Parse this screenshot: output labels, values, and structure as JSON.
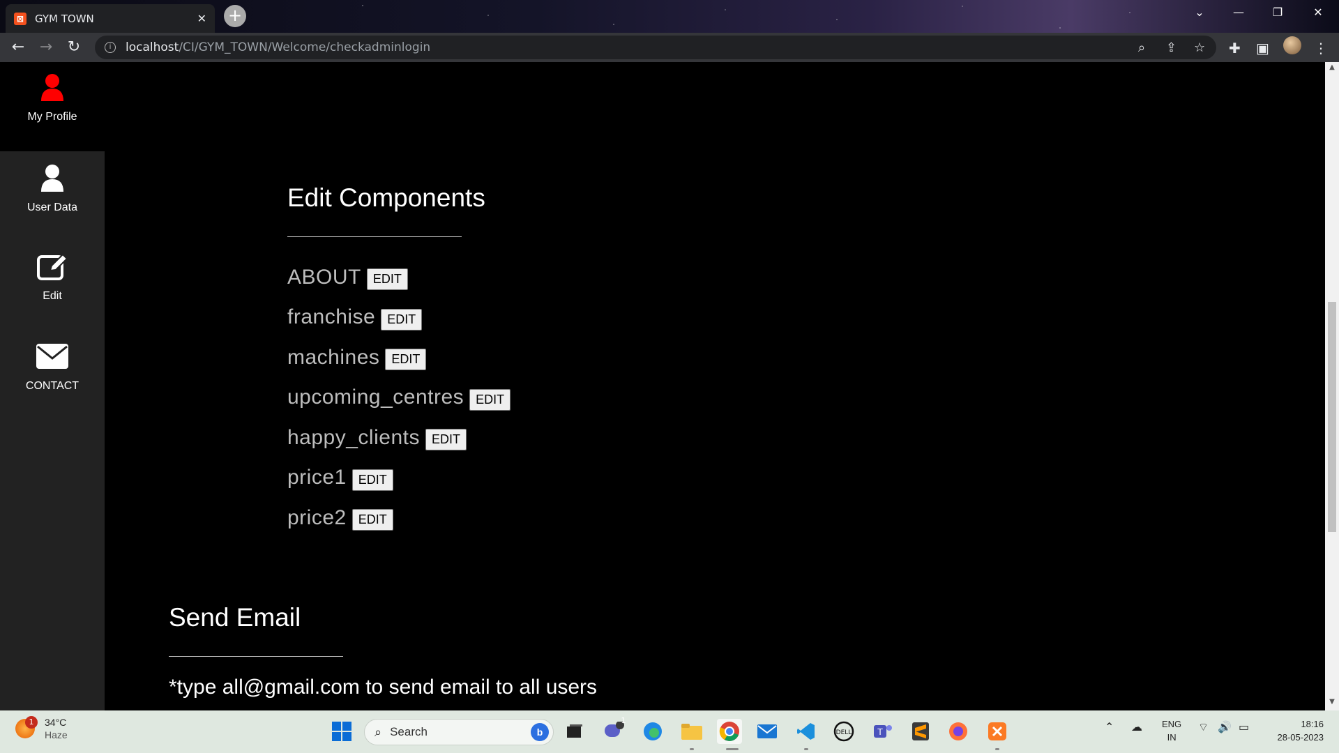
{
  "browser": {
    "tab_title": "GYM TOWN",
    "tab_favicon": "xampp-icon",
    "url_host": "localhost",
    "url_path": "/CI/GYM_TOWN/Welcome/checkadminlogin",
    "icons": [
      "back-arrow-icon",
      "forward-arrow-icon",
      "reload-icon",
      "info-icon",
      "zoom-icon",
      "share-icon",
      "bookmark-star-icon",
      "extensions-icon",
      "sidepanel-icon",
      "profile-avatar",
      "menu-dots-icon"
    ]
  },
  "sidebar": {
    "items": [
      {
        "label": "My Profile",
        "icon": "user-icon",
        "color": "#ff0000"
      },
      {
        "label": "User Data",
        "icon": "user-icon",
        "color": "#ffffff"
      },
      {
        "label": "Edit",
        "icon": "edit-icon",
        "color": "#ffffff"
      },
      {
        "label": "CONTACT",
        "icon": "envelope-icon",
        "color": "#ffffff"
      }
    ]
  },
  "edit_components": {
    "title": "Edit Components",
    "button_label": "EDIT",
    "items": [
      {
        "name": "ABOUT"
      },
      {
        "name": "franchise"
      },
      {
        "name": "machines"
      },
      {
        "name": "upcoming_centres"
      },
      {
        "name": "happy_clients"
      },
      {
        "name": "price1"
      },
      {
        "name": "price2"
      }
    ]
  },
  "send_email": {
    "title": "Send Email",
    "note": "*type all@gmail.com to send email to all users"
  },
  "taskbar": {
    "weather_badge": "1",
    "temperature": "34°C",
    "condition": "Haze",
    "search_label": "Search",
    "chat_badge": "1",
    "lang_line1": "ENG",
    "lang_line2": "IN",
    "time": "18:16",
    "date": "28-05-2023"
  }
}
